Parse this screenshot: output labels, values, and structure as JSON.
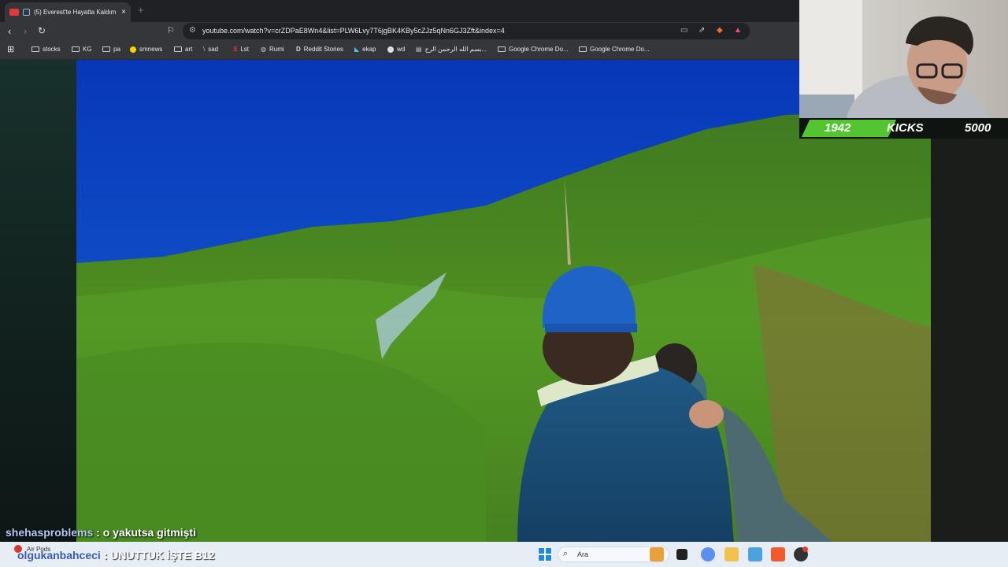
{
  "browser": {
    "tab_title": "(5) Everest'te Hayatta Kaldım",
    "url": "youtube.com/watch?v=crZDPaE8Wn4&list=PLW6Lvy7T6jgBK4KBy5cZJz5qNn6GJ3Zft&index=4",
    "bookmarks": [
      {
        "label": "stocks",
        "icon": "folder-icon"
      },
      {
        "label": "KG",
        "icon": "folder-icon"
      },
      {
        "label": "pa",
        "icon": "folder-icon"
      },
      {
        "label": "smnews",
        "icon": "yellow-dot-icon"
      },
      {
        "label": "art",
        "icon": "folder-icon"
      },
      {
        "label": "sad",
        "icon": "slash-icon"
      },
      {
        "label": "Lst",
        "icon": "s-logo-icon"
      },
      {
        "label": "Rumi",
        "icon": "globe-icon"
      },
      {
        "label": "Reddit Stories",
        "icon": "d-logo-icon"
      },
      {
        "label": "ekap",
        "icon": "e-logo-icon"
      },
      {
        "label": "wd",
        "icon": "w-logo-icon"
      },
      {
        "label": "بسم الله الرحمن الرح...",
        "icon": "doc-icon"
      },
      {
        "label": "Google Chrome Do...",
        "icon": "folder-icon"
      },
      {
        "label": "Google Chrome Do...",
        "icon": "folder-icon"
      }
    ]
  },
  "overlay": {
    "kicks_count": "1942",
    "kicks_label": "KICKS",
    "kicks_goal": "5000"
  },
  "chat": [
    {
      "user": "shehasproblems",
      "message": ": o yakutsa gitmişti"
    },
    {
      "user": "olgukanbahceci",
      "message": ": UNUTTUK İŞTE B12"
    }
  ],
  "taskbar": {
    "search_placeholder": "Ara",
    "airpods_label": "Air Pods"
  }
}
